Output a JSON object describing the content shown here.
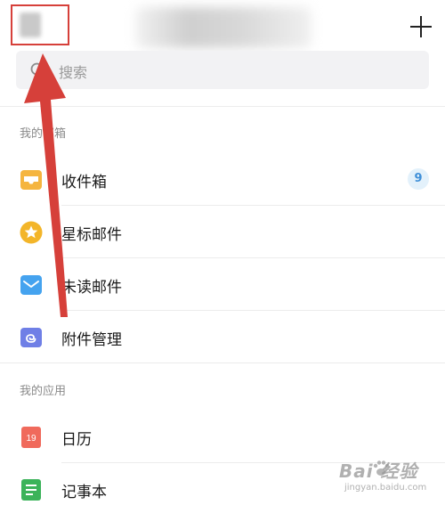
{
  "header": {
    "back_label": "",
    "title": "",
    "add_label": "+"
  },
  "search": {
    "placeholder": "搜索"
  },
  "mailboxes": {
    "section_label": "我的邮箱",
    "items": [
      {
        "label": "收件箱",
        "icon": "inbox-icon",
        "badge": "9",
        "color": "#f5b53f"
      },
      {
        "label": "星标邮件",
        "icon": "star-icon",
        "color": "#f3b529"
      },
      {
        "label": "未读邮件",
        "icon": "unread-mail-icon",
        "color": "#45a3ef"
      },
      {
        "label": "附件管理",
        "icon": "attachment-icon",
        "color": "#6f7fe6"
      }
    ]
  },
  "apps": {
    "section_label": "我的应用",
    "items": [
      {
        "label": "日历",
        "icon": "calendar-icon",
        "calendar_day": "19",
        "color": "#f06a5c"
      },
      {
        "label": "记事本",
        "icon": "notepad-icon",
        "color": "#3cb35a"
      }
    ]
  },
  "watermark": {
    "brand": "Bai 经验",
    "url": "jingyan.baidu.com"
  },
  "annotation": {
    "color": "#d6403a"
  }
}
